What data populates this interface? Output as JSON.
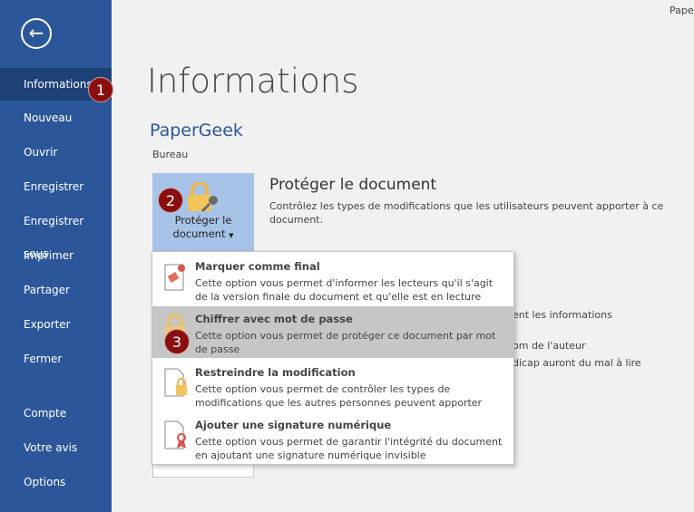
{
  "window": {
    "title_partial": "Pape"
  },
  "sidebar": {
    "back_icon": "back-arrow-icon",
    "items": [
      {
        "label": "Informations",
        "active": true
      },
      {
        "label": "Nouveau"
      },
      {
        "label": "Ouvrir"
      },
      {
        "label": "Enregistrer"
      },
      {
        "label": "Enregistrer sous"
      },
      {
        "label": "Imprimer"
      },
      {
        "label": "Partager"
      },
      {
        "label": "Exporter"
      },
      {
        "label": "Fermer"
      },
      {
        "label": "Compte"
      },
      {
        "label": "Votre avis"
      },
      {
        "label": "Options"
      }
    ]
  },
  "badges": [
    "1",
    "2",
    "3"
  ],
  "main": {
    "title": "Informations",
    "doc_name": "PaperGeek",
    "location": "Bureau",
    "protect": {
      "button_line1": "Protéger le",
      "button_line2": "document",
      "heading": "Protéger le document",
      "desc_line1": "Contrôlez les types de modifications que les utilisateurs peuvent apporter à ce",
      "desc_line2": "document."
    },
    "background_fragments": [
      "ent les informations",
      "om de l'auteur",
      "dicap auront du mal à lire",
      "document"
    ]
  },
  "menu": {
    "items": [
      {
        "title": "Marquer comme final",
        "d1": "Cette option vous permet d'informer les lecteurs qu'il s'agit",
        "d2": "de la version finale du document et qu'elle est en lecture seule",
        "icon": "stamp-icon"
      },
      {
        "title": "Chiffrer avec mot de passe",
        "d1": "Cette option vous permet de protéger ce document par mot",
        "d2": "de passe",
        "icon": "lock-key-icon",
        "hovered": true
      },
      {
        "title": "Restreindre la modification",
        "d1": "Cette option vous permet de contrôler les types de",
        "d2": "modifications que les autres personnes peuvent apporter",
        "icon": "document-lock-icon"
      },
      {
        "title": "Ajouter une signature numérique",
        "d1": "Cette option vous permet de garantir l'intégrité du document",
        "d2": "en ajoutant une signature numérique invisible",
        "icon": "document-ribbon-icon"
      }
    ]
  },
  "colors": {
    "sidebar": "#2b579a",
    "active": "#1e4176",
    "badge": "#8b0e0e",
    "button": "#a8c3e8",
    "hover": "#c6c6c6"
  }
}
